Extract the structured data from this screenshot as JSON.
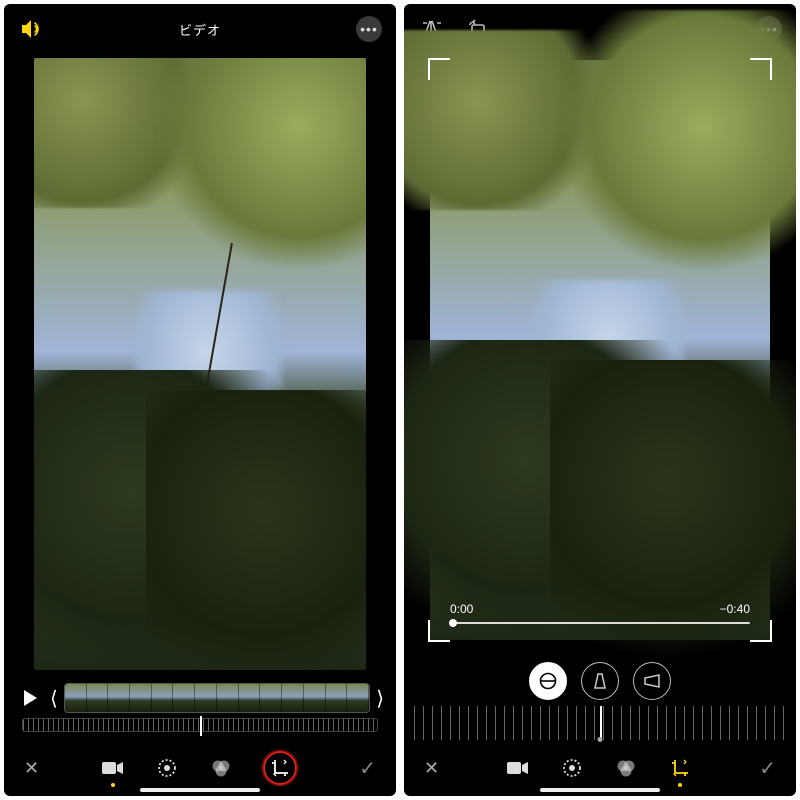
{
  "left": {
    "title": "ビデオ",
    "toolbar": {
      "cancel_glyph": "✕",
      "done_glyph": "✓"
    }
  },
  "right": {
    "time": {
      "current": "0:00",
      "remaining": "−0:40"
    },
    "toolbar": {
      "cancel_glyph": "✕",
      "done_glyph": "✓"
    }
  }
}
